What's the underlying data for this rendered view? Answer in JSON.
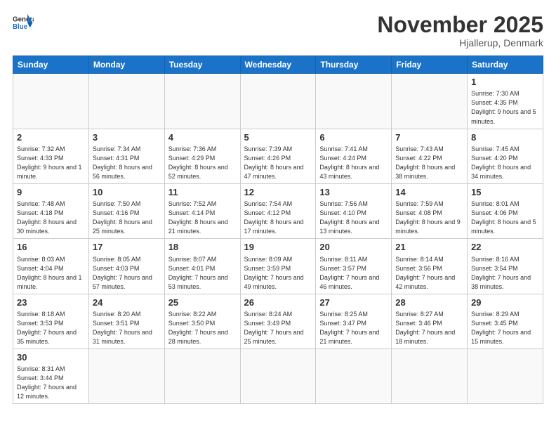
{
  "logo": {
    "text_general": "General",
    "text_blue": "Blue"
  },
  "title": "November 2025",
  "location": "Hjallerup, Denmark",
  "days_of_week": [
    "Sunday",
    "Monday",
    "Tuesday",
    "Wednesday",
    "Thursday",
    "Friday",
    "Saturday"
  ],
  "weeks": [
    [
      {
        "day": "",
        "info": ""
      },
      {
        "day": "",
        "info": ""
      },
      {
        "day": "",
        "info": ""
      },
      {
        "day": "",
        "info": ""
      },
      {
        "day": "",
        "info": ""
      },
      {
        "day": "",
        "info": ""
      },
      {
        "day": "1",
        "info": "Sunrise: 7:30 AM\nSunset: 4:35 PM\nDaylight: 9 hours and 5 minutes."
      }
    ],
    [
      {
        "day": "2",
        "info": "Sunrise: 7:32 AM\nSunset: 4:33 PM\nDaylight: 9 hours and 1 minute."
      },
      {
        "day": "3",
        "info": "Sunrise: 7:34 AM\nSunset: 4:31 PM\nDaylight: 8 hours and 56 minutes."
      },
      {
        "day": "4",
        "info": "Sunrise: 7:36 AM\nSunset: 4:29 PM\nDaylight: 8 hours and 52 minutes."
      },
      {
        "day": "5",
        "info": "Sunrise: 7:39 AM\nSunset: 4:26 PM\nDaylight: 8 hours and 47 minutes."
      },
      {
        "day": "6",
        "info": "Sunrise: 7:41 AM\nSunset: 4:24 PM\nDaylight: 8 hours and 43 minutes."
      },
      {
        "day": "7",
        "info": "Sunrise: 7:43 AM\nSunset: 4:22 PM\nDaylight: 8 hours and 38 minutes."
      },
      {
        "day": "8",
        "info": "Sunrise: 7:45 AM\nSunset: 4:20 PM\nDaylight: 8 hours and 34 minutes."
      }
    ],
    [
      {
        "day": "9",
        "info": "Sunrise: 7:48 AM\nSunset: 4:18 PM\nDaylight: 8 hours and 30 minutes."
      },
      {
        "day": "10",
        "info": "Sunrise: 7:50 AM\nSunset: 4:16 PM\nDaylight: 8 hours and 25 minutes."
      },
      {
        "day": "11",
        "info": "Sunrise: 7:52 AM\nSunset: 4:14 PM\nDaylight: 8 hours and 21 minutes."
      },
      {
        "day": "12",
        "info": "Sunrise: 7:54 AM\nSunset: 4:12 PM\nDaylight: 8 hours and 17 minutes."
      },
      {
        "day": "13",
        "info": "Sunrise: 7:56 AM\nSunset: 4:10 PM\nDaylight: 8 hours and 13 minutes."
      },
      {
        "day": "14",
        "info": "Sunrise: 7:59 AM\nSunset: 4:08 PM\nDaylight: 8 hours and 9 minutes."
      },
      {
        "day": "15",
        "info": "Sunrise: 8:01 AM\nSunset: 4:06 PM\nDaylight: 8 hours and 5 minutes."
      }
    ],
    [
      {
        "day": "16",
        "info": "Sunrise: 8:03 AM\nSunset: 4:04 PM\nDaylight: 8 hours and 1 minute."
      },
      {
        "day": "17",
        "info": "Sunrise: 8:05 AM\nSunset: 4:03 PM\nDaylight: 7 hours and 57 minutes."
      },
      {
        "day": "18",
        "info": "Sunrise: 8:07 AM\nSunset: 4:01 PM\nDaylight: 7 hours and 53 minutes."
      },
      {
        "day": "19",
        "info": "Sunrise: 8:09 AM\nSunset: 3:59 PM\nDaylight: 7 hours and 49 minutes."
      },
      {
        "day": "20",
        "info": "Sunrise: 8:11 AM\nSunset: 3:57 PM\nDaylight: 7 hours and 46 minutes."
      },
      {
        "day": "21",
        "info": "Sunrise: 8:14 AM\nSunset: 3:56 PM\nDaylight: 7 hours and 42 minutes."
      },
      {
        "day": "22",
        "info": "Sunrise: 8:16 AM\nSunset: 3:54 PM\nDaylight: 7 hours and 38 minutes."
      }
    ],
    [
      {
        "day": "23",
        "info": "Sunrise: 8:18 AM\nSunset: 3:53 PM\nDaylight: 7 hours and 35 minutes."
      },
      {
        "day": "24",
        "info": "Sunrise: 8:20 AM\nSunset: 3:51 PM\nDaylight: 7 hours and 31 minutes."
      },
      {
        "day": "25",
        "info": "Sunrise: 8:22 AM\nSunset: 3:50 PM\nDaylight: 7 hours and 28 minutes."
      },
      {
        "day": "26",
        "info": "Sunrise: 8:24 AM\nSunset: 3:49 PM\nDaylight: 7 hours and 25 minutes."
      },
      {
        "day": "27",
        "info": "Sunrise: 8:25 AM\nSunset: 3:47 PM\nDaylight: 7 hours and 21 minutes."
      },
      {
        "day": "28",
        "info": "Sunrise: 8:27 AM\nSunset: 3:46 PM\nDaylight: 7 hours and 18 minutes."
      },
      {
        "day": "29",
        "info": "Sunrise: 8:29 AM\nSunset: 3:45 PM\nDaylight: 7 hours and 15 minutes."
      }
    ],
    [
      {
        "day": "30",
        "info": "Sunrise: 8:31 AM\nSunset: 3:44 PM\nDaylight: 7 hours and 12 minutes."
      },
      {
        "day": "",
        "info": ""
      },
      {
        "day": "",
        "info": ""
      },
      {
        "day": "",
        "info": ""
      },
      {
        "day": "",
        "info": ""
      },
      {
        "day": "",
        "info": ""
      },
      {
        "day": "",
        "info": ""
      }
    ]
  ]
}
